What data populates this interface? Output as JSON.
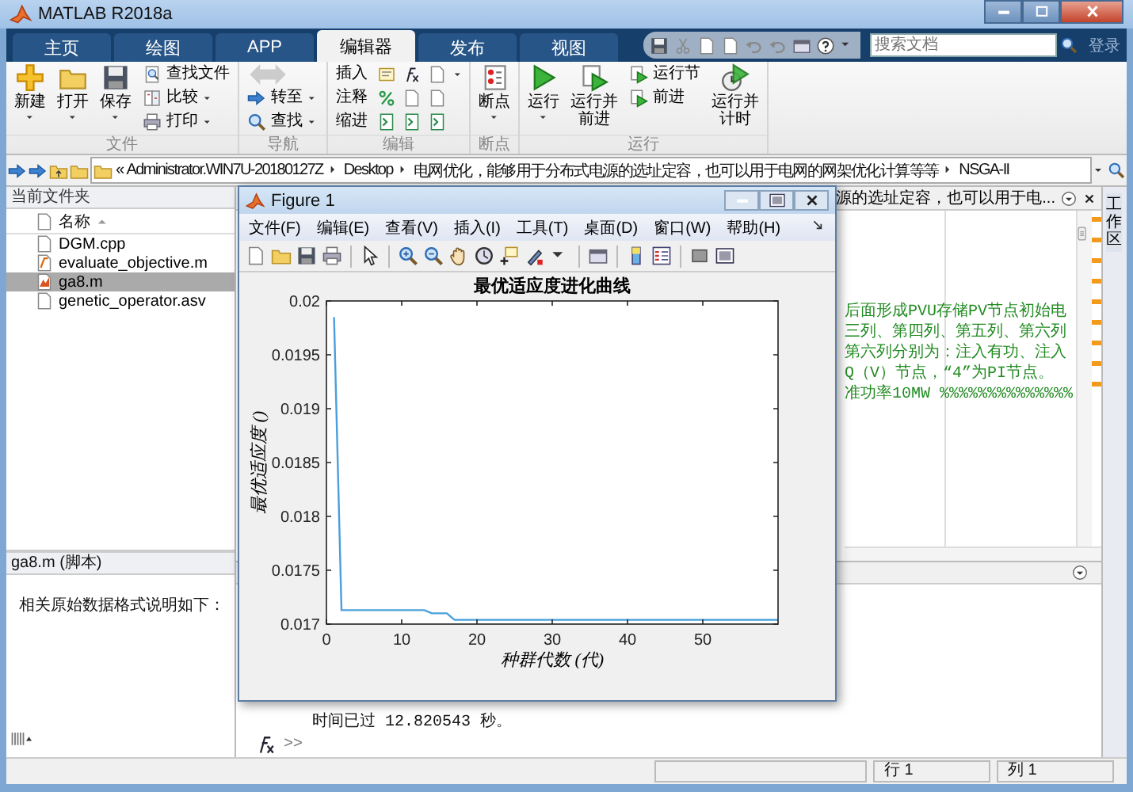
{
  "window": {
    "title": "MATLAB R2018a"
  },
  "tabs": [
    {
      "label": "主页",
      "selected": false
    },
    {
      "label": "绘图",
      "selected": false
    },
    {
      "label": "APP",
      "selected": false
    },
    {
      "label": "编辑器",
      "selected": true
    },
    {
      "label": "发布",
      "selected": false
    },
    {
      "label": "视图",
      "selected": false
    }
  ],
  "search": {
    "placeholder": "搜索文档"
  },
  "sign_in": "登录",
  "ribbon": [
    {
      "label": "文件",
      "buttons": [
        {
          "kind": "large",
          "label": "新建",
          "dropdown": true
        },
        {
          "kind": "large",
          "label": "打开",
          "dropdown": true
        },
        {
          "kind": "large",
          "label": "保存",
          "dropdown": true
        },
        {
          "kind": "small",
          "label": "查找文件",
          "dropdown": false
        },
        {
          "kind": "small",
          "label": "比较",
          "dropdown": true
        },
        {
          "kind": "small",
          "label": "打印",
          "dropdown": true
        }
      ]
    },
    {
      "label": "导航",
      "buttons": [
        {
          "kind": "small",
          "label": "转至",
          "dropdown": true
        },
        {
          "kind": "small",
          "label": "查找",
          "dropdown": true
        }
      ]
    },
    {
      "label": "编辑",
      "buttons": [
        {
          "kind": "row",
          "label": "插入",
          "dropdown": true
        },
        {
          "kind": "row",
          "label": "注释",
          "dropdown": false
        },
        {
          "kind": "row",
          "label": "缩进",
          "dropdown": false
        }
      ]
    },
    {
      "label": "断点",
      "buttons": [
        {
          "kind": "large",
          "label": "断点",
          "dropdown": true
        }
      ]
    },
    {
      "label": "运行",
      "buttons": [
        {
          "kind": "large",
          "label": "运行",
          "dropdown": true
        },
        {
          "kind": "large",
          "lines": [
            "运行并",
            "前进"
          ],
          "dropdown": false
        },
        {
          "kind": "small",
          "label": "运行节",
          "dropdown": false
        },
        {
          "kind": "small",
          "label": "前进",
          "dropdown": false
        },
        {
          "kind": "large",
          "lines": [
            "运行并",
            "计时"
          ],
          "dropdown": false
        }
      ]
    }
  ],
  "address": {
    "prefix": "«",
    "segments": [
      "Administrator.WIN7U-20180127Z",
      "Desktop",
      "电网优化，能够用于分布式电源的选址定容，也可以用于电网的网架优化计算等等",
      "NSGA-II"
    ]
  },
  "current_folder": {
    "title": "当前文件夹",
    "column": "名称",
    "items": [
      {
        "name": "DGM.cpp",
        "kind": "text",
        "selected": false
      },
      {
        "name": "evaluate_objective.m",
        "kind": "function",
        "selected": false
      },
      {
        "name": "ga8.m",
        "kind": "script",
        "selected": true
      },
      {
        "name": "genetic_operator.asv",
        "kind": "text",
        "selected": false
      }
    ]
  },
  "details": {
    "title": "ga8.m  (脚本)",
    "description": "相关原始数据格式说明如下："
  },
  "editor": {
    "tab": "源的选址定容，也可以用于电...",
    "lines": [
      "后面形成PVU存储PV节点初始电",
      "三列、第四列、第五列、第六列",
      "第六列分别为：注入有功、注入",
      "Q（V）节点，“4”为PI节点。",
      "准功率10MW %%%%%%%%%%%%%%"
    ]
  },
  "command_window": {
    "lines": [
      "时间已过 12.820543 秒。"
    ],
    "prompt": ">>"
  },
  "workspace_tab": "工作区",
  "status_bar": {
    "row": "行  1",
    "col": "列  1"
  },
  "figure": {
    "title": "Figure 1",
    "menu": [
      "文件(F)",
      "编辑(E)",
      "查看(V)",
      "插入(I)",
      "工具(T)",
      "桌面(D)",
      "窗口(W)",
      "帮助(H)"
    ],
    "chart_data": {
      "type": "line",
      "title": "最优适应度进化曲线",
      "xlabel": "种群代数 (代)",
      "ylabel": "最优适应度 ()",
      "x": [
        1,
        2,
        13,
        14,
        16,
        17,
        60
      ],
      "series": [
        {
          "color": "#4a9fdc",
          "values": [
            0.01985,
            0.01713,
            0.01713,
            0.0171,
            0.0171,
            0.01704,
            0.01704
          ]
        }
      ],
      "xlim": [
        0,
        60
      ],
      "ylim": [
        0.017,
        0.02
      ],
      "xticks": [
        0,
        10,
        20,
        30,
        40,
        50
      ],
      "yticks": [
        0.017,
        0.0175,
        0.018,
        0.0185,
        0.019,
        0.0195,
        0.02
      ]
    }
  }
}
